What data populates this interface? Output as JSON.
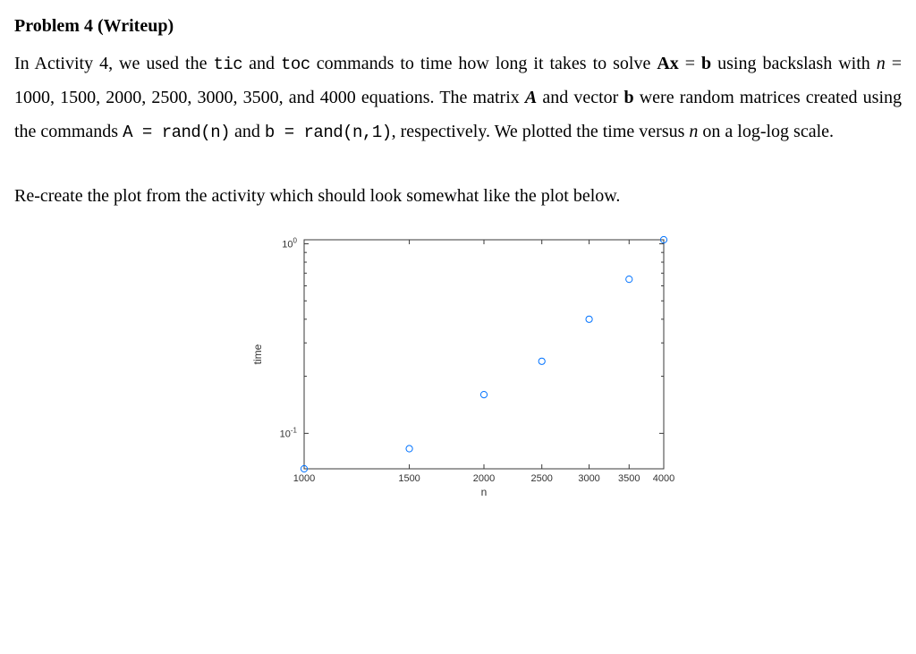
{
  "heading": "Problem 4 (Writeup)",
  "text": {
    "p1_a": "In Activity 4, we used the ",
    "tic": "tic",
    "p1_b": " and ",
    "toc": "toc",
    "p1_c": " commands to time how long it takes to solve ",
    "ax": "Ax",
    "eq": " = ",
    "b": "b",
    "p1_d": " using backslash with ",
    "n": "n",
    "p1_e": " = 1000, 1500, 2000, 2500, 3000, 3500, and 4000 equations. The matrix ",
    "A": "A",
    "p1_f": " and vector ",
    "bvec": "b",
    "p1_g": " were random matrices created using the commands",
    "randA": "A = rand(n)",
    "p1_h": " and ",
    "randb": "b = rand(n,1)",
    "p1_i": ", respectively.  We plotted the time versus ",
    "n2": "n",
    "p1_j": " on a log-log scale.",
    "p2": "Re-create the plot from the activity which should look somewhat like the plot below."
  },
  "chart_data": {
    "type": "scatter",
    "x": [
      1000,
      1500,
      2000,
      2500,
      3000,
      3500,
      4000
    ],
    "y": [
      0.065,
      0.083,
      0.16,
      0.24,
      0.4,
      0.65,
      1.05
    ],
    "xlabel": "n",
    "ylabel": "time",
    "xscale": "log",
    "yscale": "log",
    "xticks": [
      1000,
      1500,
      2000,
      2500,
      3000,
      3500,
      4000
    ],
    "xticklabels": [
      "1000",
      "1500",
      "2000",
      "2500",
      "3000",
      "3500",
      "4000"
    ],
    "yticks": [
      0.1,
      1
    ],
    "yticklabels_base": "10",
    "yticklabels_exp": [
      "-1",
      "0"
    ],
    "xlim": [
      1000,
      4000
    ],
    "ylim": [
      0.065,
      1.05
    ],
    "marker_color": "#0072ff"
  }
}
